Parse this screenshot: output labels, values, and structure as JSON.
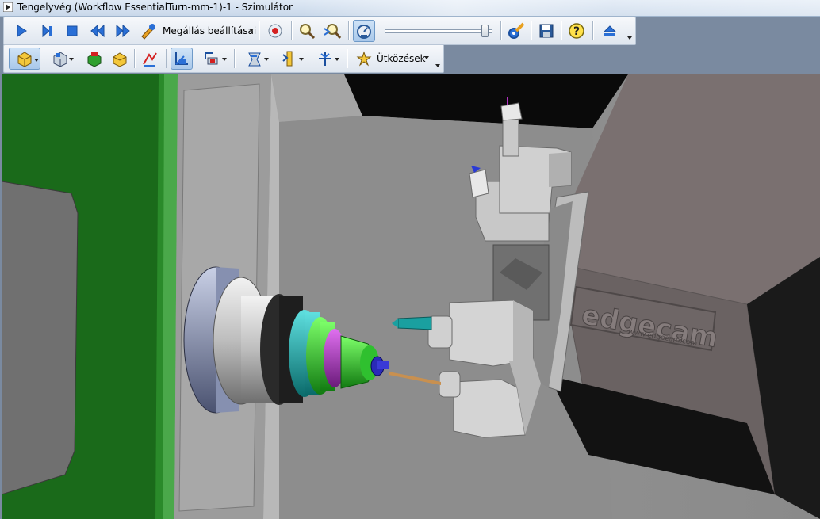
{
  "window": {
    "title": "Tengelyvég (Workflow EssentialTurn-mm-1)-1 - Szimulátor"
  },
  "toolbar_main": {
    "stop_settings_label": "Megállás beállításai",
    "speed_slider_value": 0.96,
    "icons": [
      "play-icon",
      "step-icon",
      "stop-icon",
      "rewind-icon",
      "fast-forward-icon",
      "stop-settings-icon",
      "record-icon",
      "zoom-icon",
      "zoom-fit-icon",
      "speed-gauge-icon",
      "settings-icon",
      "save-icon",
      "help-icon",
      "eject-icon"
    ]
  },
  "toolbar_view": {
    "collisions_label": "Ütközések",
    "icons": [
      "stock-view-icon",
      "part-view-icon",
      "fixture-view-icon",
      "tool-view-icon",
      "toolpath-icon",
      "axis-view-icon",
      "coordinate-view-icon",
      "turret-view-icon",
      "tool-select-icon",
      "tool-holder-icon",
      "collision-icon"
    ]
  },
  "viewport": {
    "brand_text": "edgecam",
    "brand_url": "www.edgecam.com"
  },
  "colors": {
    "accent_blue": "#2a6fd6",
    "machine_green": "#1a7a1a",
    "part_teal": "#1aa0a0",
    "part_green": "#2fc02f",
    "part_purple": "#b030c0"
  }
}
